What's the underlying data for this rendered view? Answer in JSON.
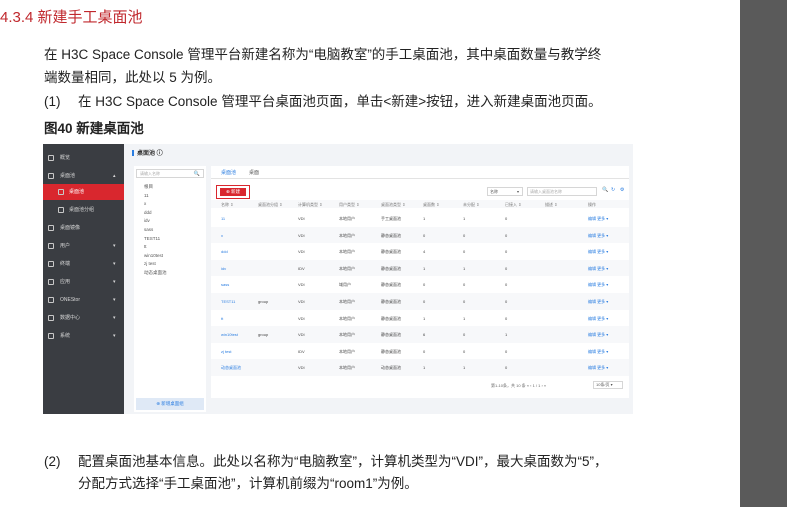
{
  "doc": {
    "section_title": "4.3.4  新建手工桌面池",
    "intro_line1": "在 H3C Space Console 管理平台新建名称为“电脑教室”的手工桌面池，其中桌面数量与教学终",
    "intro_line2": "端数量相同，此处以 5 为例。",
    "step1_num": "(1)",
    "step1_text": "在 H3C Space Console 管理平台桌面池页面，单击<新建>按钮，进入新建桌面池页面。",
    "figure_caption": "图40  新建桌面池",
    "step2_num": "(2)",
    "step2_line1": "配置桌面池基本信息。此处以名称为“电脑教室”，计算机类型为“VDI”，最大桌面数为“5”，",
    "step2_line2": "分配方式选择“手工桌面池”，计算机前缀为“room1”为例。"
  },
  "screenshot": {
    "sidebar": [
      {
        "label": "概览",
        "arrow": ""
      },
      {
        "label": "桌面池",
        "arrow": "▴"
      },
      {
        "label": "桌面池",
        "arrow": ""
      },
      {
        "label": "桌面池分组",
        "arrow": ""
      },
      {
        "label": "桌面镜像",
        "arrow": ""
      },
      {
        "label": "用户",
        "arrow": "▾"
      },
      {
        "label": "终端",
        "arrow": "▾"
      },
      {
        "label": "应用",
        "arrow": "▾"
      },
      {
        "label": "ONEStor",
        "arrow": "▾"
      },
      {
        "label": "数据中心",
        "arrow": "▾"
      },
      {
        "label": "系统",
        "arrow": "▾"
      }
    ],
    "page_title": "桌面池 ⓘ",
    "tree": {
      "search_placeholder": "请输入名称",
      "search_icon": "🔍",
      "items": [
        "根目",
        "11",
        "x",
        "ddd",
        "idv",
        "sass",
        "TEST11",
        "tt",
        "win10test",
        "zj test",
        "动态桌面池"
      ],
      "add_button": "⊕ 新增桌面组"
    },
    "tabs": [
      "桌面池",
      "桌面"
    ],
    "new_button": "⊕ 新建",
    "filter_select": "名称",
    "filter_select_arrow": "▾",
    "filter_placeholder": "请输入桌面池名称",
    "tool_icons": [
      "🔍",
      "↻",
      "⚙"
    ],
    "columns": [
      "名称 ⇕",
      "桌面池分组 ⇕",
      "计算机类型 ⇕",
      "用户类型 ⇕",
      "桌面池类型 ⇕",
      "桌面数 ⇕",
      "未分配 ⇕",
      "已接入 ⇕",
      "描述 ⇕",
      "操作"
    ],
    "rows": [
      [
        "11",
        "",
        "VDI",
        "本地用户",
        "手工桌面池",
        "1",
        "1",
        "0",
        "",
        "编辑  更多 ▾"
      ],
      [
        "x",
        "",
        "VDI",
        "本地用户",
        "静态桌面池",
        "0",
        "0",
        "0",
        "",
        "编辑  更多 ▾"
      ],
      [
        "ddd",
        "",
        "VDI",
        "本地用户",
        "静态桌面池",
        "4",
        "0",
        "0",
        "",
        "编辑  更多 ▾"
      ],
      [
        "idv",
        "",
        "IDV",
        "本地用户",
        "静态桌面池",
        "1",
        "1",
        "0",
        "",
        "编辑  更多 ▾"
      ],
      [
        "sass",
        "",
        "VDI",
        "域用户",
        "静态桌面池",
        "0",
        "0",
        "0",
        "",
        "编辑  更多 ▾"
      ],
      [
        "TEST11",
        "group",
        "VDI",
        "本地用户",
        "静态桌面池",
        "0",
        "0",
        "0",
        "",
        "编辑  更多 ▾"
      ],
      [
        "tt",
        "",
        "VDI",
        "本地用户",
        "静态桌面池",
        "1",
        "1",
        "0",
        "",
        "编辑  更多 ▾"
      ],
      [
        "win10test",
        "group",
        "VDI",
        "本地用户",
        "静态桌面池",
        "6",
        "0",
        "1",
        "",
        "编辑  更多 ▾"
      ],
      [
        "zj test",
        "",
        "IDV",
        "本地用户",
        "静态桌面池",
        "0",
        "0",
        "0",
        "",
        "编辑  更多 ▾"
      ],
      [
        "动态桌面池",
        "",
        "VDI",
        "本地用户",
        "动态桌面池",
        "1",
        "1",
        "0",
        "",
        "编辑  更多 ▾"
      ]
    ],
    "pager_text": "第1-10条，共 10 条   «  ‹  1 / 1  ›  »",
    "page_size": "10条/页 ▾"
  }
}
